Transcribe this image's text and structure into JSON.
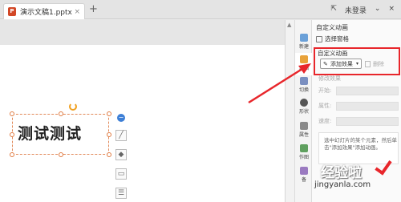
{
  "tab": {
    "filename": "演示文稿1.pptx",
    "close": "×",
    "add": "+",
    "ppt_icon": "P"
  },
  "window": {
    "controls": [
      "⇱",
      "未登录",
      "⌄",
      "×"
    ]
  },
  "slide": {
    "text": "测试测试"
  },
  "quick_tools": [
    "−",
    "╱",
    "◆",
    "▭",
    "☰"
  ],
  "rail": [
    {
      "label": "新建",
      "icon": "new-icon",
      "color": "#6aa0d8"
    },
    {
      "label": "动画",
      "icon": "animation-icon",
      "color": "#e8a23a"
    },
    {
      "label": "切换",
      "icon": "transition-icon",
      "color": "#7a8fc0"
    },
    {
      "label": "形状",
      "icon": "shape-icon",
      "color": "#555555"
    },
    {
      "label": "属性",
      "icon": "properties-icon",
      "color": "#8a8a8a"
    },
    {
      "label": "作图",
      "icon": "draw-icon",
      "color": "#5fa05f"
    },
    {
      "label": "备",
      "icon": "more-icon",
      "color": "#9a7ac0"
    }
  ],
  "pane": {
    "title": "自定义动画",
    "selection_pane": "选择窗格",
    "custom_group_title": "自定义动画",
    "add_effect": "添加效果",
    "add_caret": "▾",
    "remove": "删除",
    "modify_title": "修改效果",
    "fields": [
      "开始:",
      "属性:",
      "速度:"
    ],
    "hint": "选中幻灯片的某个元素，然后单击\"添加效果\"添加动画。"
  },
  "watermark": {
    "title": "经验啦",
    "url": "jingyanla.com"
  },
  "colors": {
    "highlight": "#e8262b",
    "accent": "#3d7fd6"
  }
}
